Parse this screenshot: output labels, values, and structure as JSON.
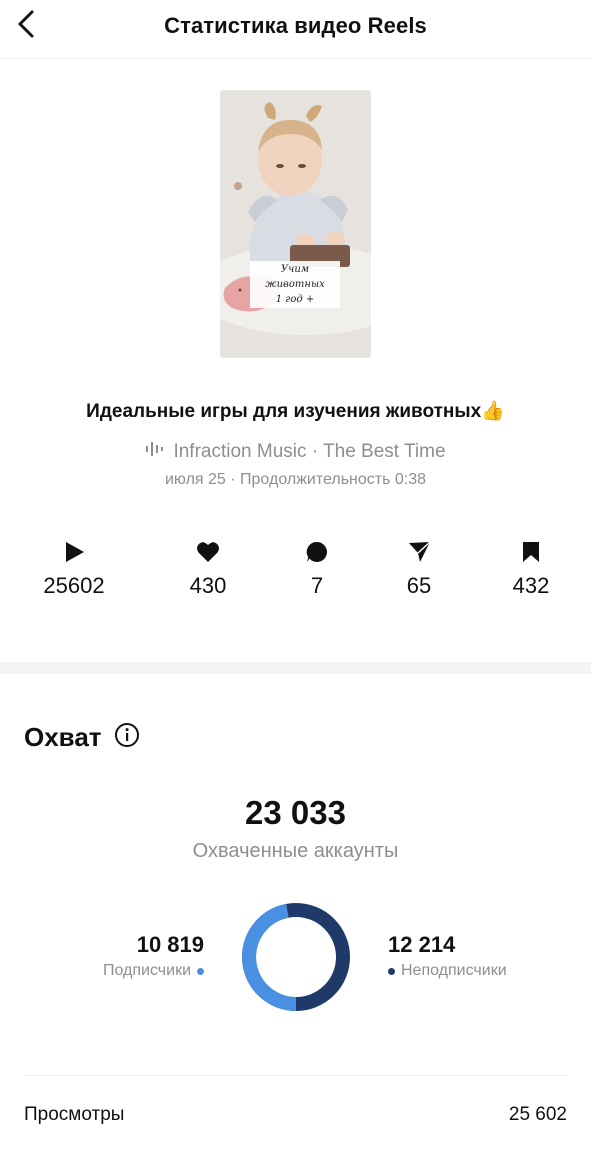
{
  "header": {
    "title": "Статистика видео Reels",
    "back_icon": "chevron-left-icon"
  },
  "thumbnail": {
    "caption_line1": "Учим животных",
    "caption_line2": "1 год +"
  },
  "post": {
    "title": "Идеальные игры для изучения животных👍",
    "music": "Infraction Music · The Best Time",
    "music_icon": "audio-bars-icon",
    "meta": "июля 25 · Продолжительность 0:38"
  },
  "stats": [
    {
      "icon": "play-icon",
      "value": "25602"
    },
    {
      "icon": "heart-icon",
      "value": "430"
    },
    {
      "icon": "comment-icon",
      "value": "7"
    },
    {
      "icon": "share-icon",
      "value": "65"
    },
    {
      "icon": "bookmark-icon",
      "value": "432"
    }
  ],
  "reach": {
    "title": "Охват",
    "info_icon": "info-icon",
    "total": "23 033",
    "subtitle": "Охваченные аккаунты",
    "followers": {
      "value": "10 819",
      "label": "Подписчики",
      "color": "#4a90e2"
    },
    "non_followers": {
      "value": "12 214",
      "label": "Неподписчики",
      "color": "#1f3a68"
    },
    "followers_share": 0.47
  },
  "views": {
    "label": "Просмотры",
    "value": "25 602"
  }
}
